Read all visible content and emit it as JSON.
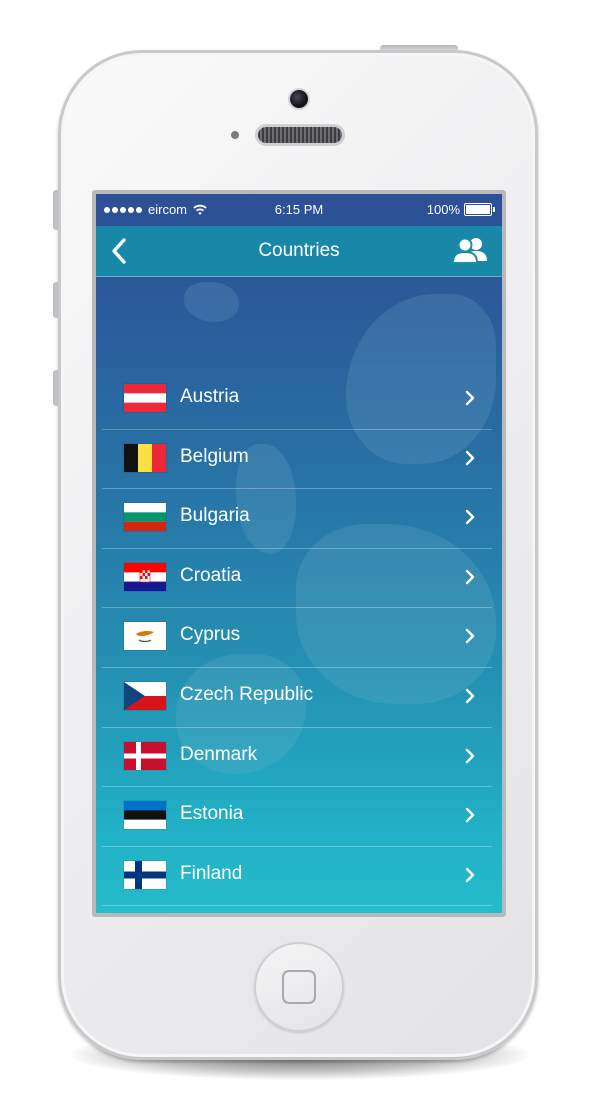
{
  "status_bar": {
    "carrier": "eircom",
    "time": "6:15 PM",
    "battery": "100%"
  },
  "nav": {
    "title": "Countries",
    "back_icon": "chevron-left-icon",
    "right_icon": "contacts-icon"
  },
  "countries": [
    {
      "name": "Austria",
      "flag": "austria"
    },
    {
      "name": "Belgium",
      "flag": "belgium"
    },
    {
      "name": "Bulgaria",
      "flag": "bulgaria"
    },
    {
      "name": "Croatia",
      "flag": "croatia"
    },
    {
      "name": "Cyprus",
      "flag": "cyprus"
    },
    {
      "name": "Czech Republic",
      "flag": "czech-republic"
    },
    {
      "name": "Denmark",
      "flag": "denmark"
    },
    {
      "name": "Estonia",
      "flag": "estonia"
    },
    {
      "name": "Finland",
      "flag": "finland"
    }
  ],
  "colors": {
    "nav_bar": "#178eaa",
    "gradient_top": "#2d4f95",
    "gradient_bottom": "#25bccb",
    "text": "#ffffff"
  }
}
